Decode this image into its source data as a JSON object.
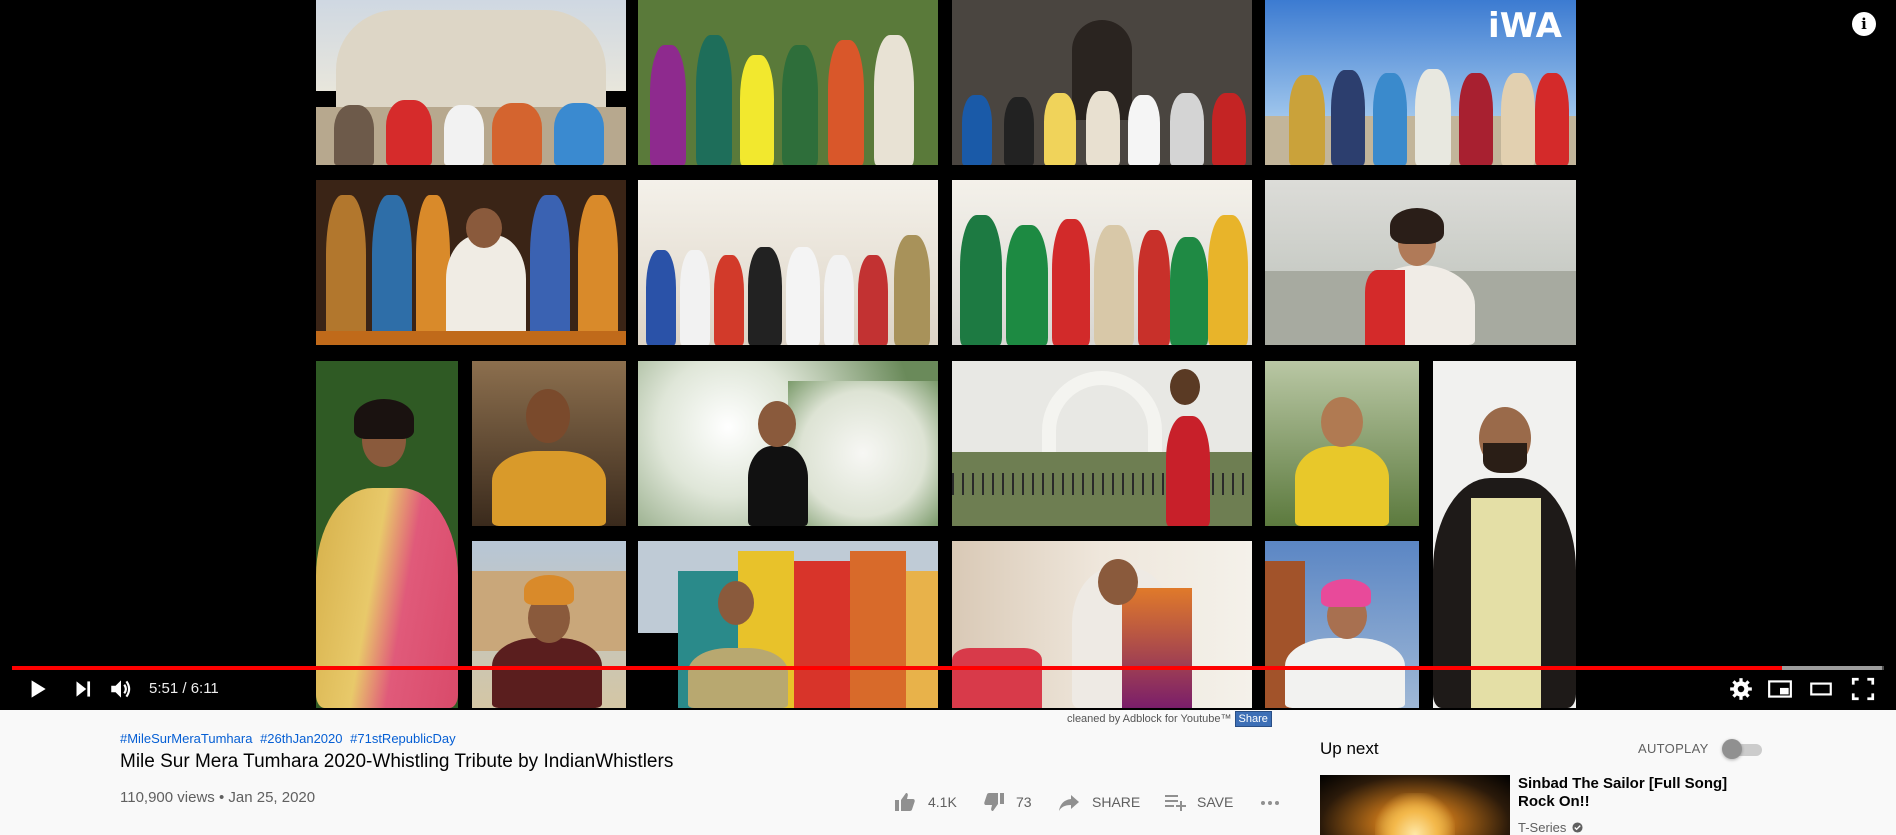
{
  "player": {
    "time_display": "5:51 / 6:11",
    "progress_fraction": 0.9455,
    "buffer_fraction": 0.999,
    "info_label": "i",
    "watermark_text": "iWA"
  },
  "adblock": {
    "text": "cleaned by Adblock for Youtube™",
    "share_label": "Share"
  },
  "video": {
    "hashtags": [
      "#MileSurMeraTumhara",
      "#26thJan2020",
      "#71stRepublicDay"
    ],
    "title": "Mile Sur Mera Tumhara 2020-Whistling Tribute by IndianWhistlers",
    "views_date": "110,900 views • Jan 25, 2020",
    "likes": "4.1K",
    "dislikes": "73",
    "share_label": "SHARE",
    "save_label": "SAVE",
    "more_label": "..."
  },
  "sidebar": {
    "up_next_label": "Up next",
    "autoplay_label": "AUTOPLAY",
    "autoplay_on": false,
    "next_video": {
      "title": "Sinbad The Sailor [Full Song] Rock On!!",
      "channel": "T-Series"
    }
  },
  "icons": {
    "play": "play-icon",
    "next": "skip-next-icon",
    "volume": "volume-icon",
    "settings": "gear-icon",
    "miniplayer": "miniplayer-icon",
    "theater": "theater-mode-icon",
    "fullscreen": "fullscreen-icon",
    "like": "thumbs-up-icon",
    "dislike": "thumbs-down-icon",
    "share": "share-arrow-icon",
    "save": "playlist-add-icon",
    "more": "more-horizontal-icon",
    "verified": "verified-check-icon"
  },
  "colors": {
    "progress_red": "#ff0000",
    "link_blue": "#065fd4"
  }
}
